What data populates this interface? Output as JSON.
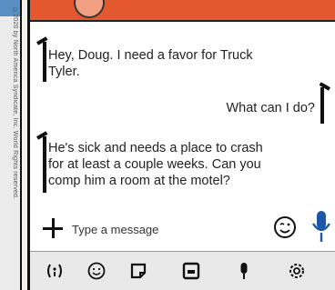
{
  "copyright": {
    "text": "©2020 by North America Syndicate, Inc. World Rights reserved."
  },
  "conversation": {
    "messages": [
      {
        "direction": "incoming",
        "lines": [
          "Hey, Doug. I need a favor for Truck",
          "Tyler."
        ]
      },
      {
        "direction": "outgoing",
        "lines": [
          "What can I do?"
        ]
      },
      {
        "direction": "incoming",
        "lines": [
          "He's sick and needs a place to crash",
          "for at least a couple weeks. Can you",
          "comp him a room at the motel?"
        ]
      }
    ]
  },
  "composer": {
    "placeholder": "Type a message"
  },
  "toolbar": {
    "icons": [
      "gif-icon",
      "emoji-icon",
      "sticker-icon",
      "image-icon",
      "microphone-icon",
      "settings-icon"
    ]
  },
  "colors": {
    "header": "#e3582f",
    "toolbar": "#e9e9e9",
    "text": "#222222"
  }
}
